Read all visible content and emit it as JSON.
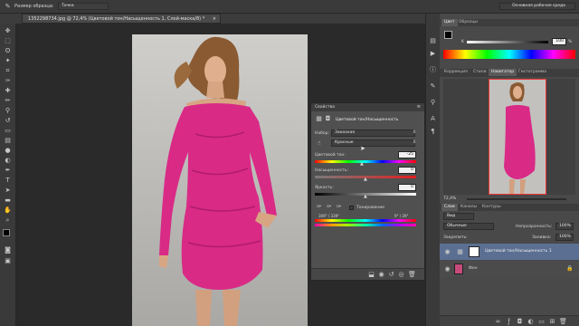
{
  "optbar": {
    "sample_size_label": "Размер образца:",
    "sample_size_value": "Точка",
    "workspace": "Основная рабочая среда"
  },
  "doc_tab": {
    "title": "1352298734.jpg @ 72,4% (Цветовой тон/Насыщенность 1, Слой-маска/8) *",
    "close": "×"
  },
  "properties": {
    "title": "Свойства",
    "subtitle": "Цветовой тон/Насыщенность",
    "preset_label": "Набор:",
    "preset_value": "Заказная",
    "channel_value": "Красные",
    "hue_label": "Цветовой тон:",
    "hue_value": "-25",
    "saturation_label": "Насыщенность:",
    "saturation_value": "0",
    "lightness_label": "Яркость:",
    "lightness_value": "0",
    "colorize_label": "Тонирование",
    "range_left": "309° / 339°",
    "range_right": "9° \\ 39°"
  },
  "color_panel": {
    "tab_color": "Цвет",
    "tab_swatches": "Образцы",
    "k_label": "K",
    "k_value": "100",
    "k_unit": "%"
  },
  "navigator_panel": {
    "tab_correction": "Коррекция",
    "tab_styles": "Стили",
    "tab_navigator": "Навигатор",
    "tab_histogram": "Гистограмма",
    "zoom": "72,4%"
  },
  "layers_panel": {
    "tab_layers": "Слои",
    "tab_channels": "Каналы",
    "tab_paths": "Контуры",
    "filter_label": "Вид",
    "blend_mode": "Обычные",
    "opacity_label": "Непрозрачность:",
    "opacity_value": "100%",
    "lock_label": "Закрепить:",
    "fill_label": "Заливка:",
    "fill_value": "100%",
    "layers": [
      {
        "name": "Цветовой тон/Насыщенность 1"
      },
      {
        "name": "Фон"
      }
    ]
  },
  "colors": {
    "dress": "#d92a86",
    "selected_layer": "#5b6f92",
    "panel": "#494949"
  }
}
